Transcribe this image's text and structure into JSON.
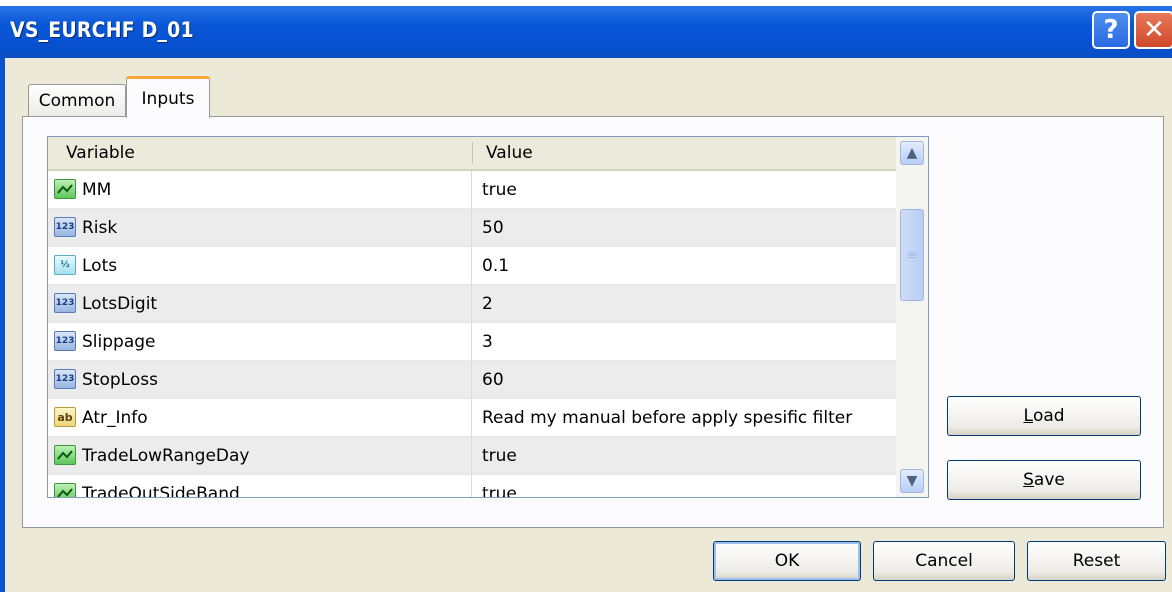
{
  "window": {
    "title": "VS_EURCHF D_01"
  },
  "titlebar": {
    "help_glyph": "?",
    "close_glyph": "✕"
  },
  "tabs": [
    {
      "label": "Common",
      "active": false
    },
    {
      "label": "Inputs",
      "active": true
    }
  ],
  "grid": {
    "columns": [
      "Variable",
      "Value"
    ],
    "rows": [
      {
        "icon": "bool",
        "icon_label": "",
        "name": "MM",
        "value": "true"
      },
      {
        "icon": "int",
        "icon_label": "123",
        "name": "Risk",
        "value": "50"
      },
      {
        "icon": "double",
        "icon_label": "½",
        "name": "Lots",
        "value": "0.1"
      },
      {
        "icon": "int",
        "icon_label": "123",
        "name": "LotsDigit",
        "value": "2"
      },
      {
        "icon": "int",
        "icon_label": "123",
        "name": "Slippage",
        "value": "3"
      },
      {
        "icon": "int",
        "icon_label": "123",
        "name": "StopLoss",
        "value": "60"
      },
      {
        "icon": "string",
        "icon_label": "ab",
        "name": "Atr_Info",
        "value": "Read my manual before apply spesific filter"
      },
      {
        "icon": "bool",
        "icon_label": "",
        "name": "TradeLowRangeDay",
        "value": "true"
      },
      {
        "icon": "bool",
        "icon_label": "",
        "name": "TradeOutSideBand",
        "value": "true"
      }
    ],
    "scroll": {
      "up_glyph": "▲",
      "down_glyph": "▼",
      "thumb_glyph": "≡"
    }
  },
  "side_buttons": {
    "load": {
      "mnemonic": "L",
      "rest": "oad"
    },
    "save": {
      "mnemonic": "S",
      "rest": "ave"
    }
  },
  "footer_buttons": {
    "ok": "OK",
    "cancel": "Cancel",
    "reset": "Reset"
  }
}
